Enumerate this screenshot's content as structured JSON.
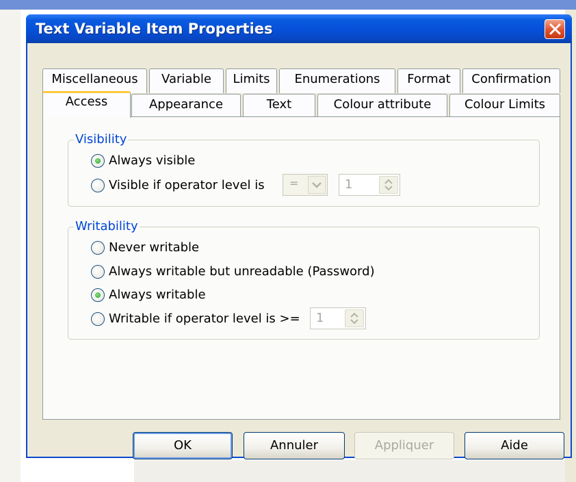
{
  "dialog": {
    "title": "Text Variable Item Properties"
  },
  "tabs_row1": [
    "Miscellaneous",
    "Variable",
    "Limits",
    "Enumerations",
    "Format",
    "Confirmation"
  ],
  "tabs_row2": [
    "Access",
    "Appearance",
    "Text",
    "Colour attribute",
    "Colour Limits"
  ],
  "active_tab": "Access",
  "visibility": {
    "title": "Visibility",
    "options": [
      "Always visible",
      "Visible if operator level is"
    ],
    "selected": "Always visible",
    "operator_value": "=",
    "level_value": "1"
  },
  "writability": {
    "title": "Writability",
    "options": [
      "Never writable",
      "Always writable but unreadable (Password)",
      "Always writable",
      "Writable if operator level is >="
    ],
    "selected": "Always writable",
    "level_value": "1"
  },
  "buttons": {
    "ok": "OK",
    "cancel": "Annuler",
    "apply": "Appliquer",
    "help": "Aide"
  },
  "colors": {
    "titlebar": "#0a5be0",
    "group_title": "#0046d5",
    "active_tab_highlight": "#ffc83c",
    "close_button": "#e0522d"
  }
}
